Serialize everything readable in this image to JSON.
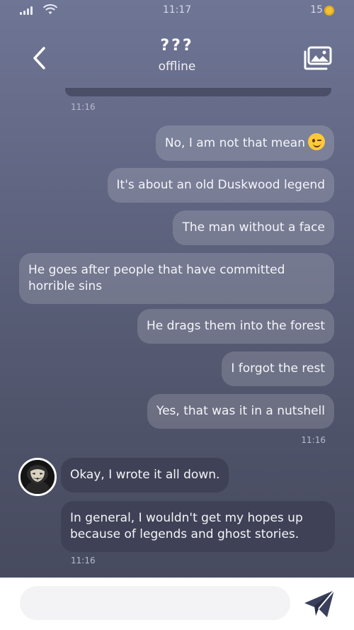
{
  "status_bar": {
    "time": "11:17",
    "coins": "15",
    "icons": [
      "signal-icon",
      "wifi-icon",
      "coin-icon"
    ]
  },
  "header": {
    "title": "???",
    "subtitle": "offline",
    "icons": [
      "back-chevron-icon",
      "gallery-icon"
    ]
  },
  "chat": {
    "top_timestamp": "11:16",
    "outgoing": [
      {
        "text": "No, I am not that mean",
        "emoji": "winking-face-emoji"
      },
      {
        "text": "It's about an old Duskwood legend"
      },
      {
        "text": "The man without a face"
      },
      {
        "text": "He goes after people that have committed",
        "text2": "horrible sins"
      },
      {
        "text": "He drags them into the forest"
      },
      {
        "text": "I forgot the rest"
      },
      {
        "text": "Yes, that was it in a nutshell"
      }
    ],
    "outgoing_timestamp": "11:16",
    "incoming": [
      {
        "text": "Okay, I wrote it all down."
      },
      {
        "text": "In general, I wouldn't get my hopes up",
        "text2": "because of legends and ghost stories."
      }
    ],
    "incoming_timestamp": "11:16",
    "avatar_icon": "masked-contact-avatar"
  },
  "composer": {
    "placeholder": "",
    "send_icon": "send-paper-plane-icon"
  },
  "colors": {
    "background_top": "#6f7595",
    "background_bottom": "#45485c",
    "incoming_bubble": "#3f4256",
    "coin": "#f2c230"
  }
}
